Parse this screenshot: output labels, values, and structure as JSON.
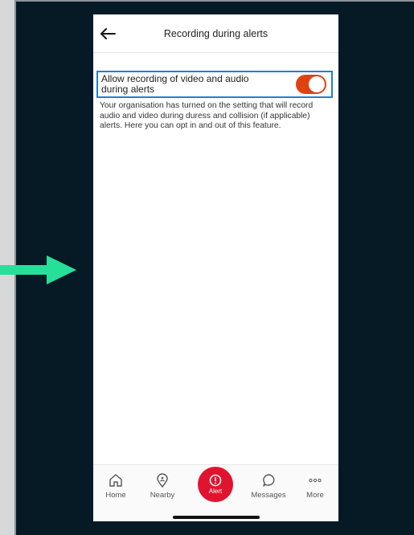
{
  "header": {
    "title": "Recording during alerts"
  },
  "setting": {
    "label": "Allow recording of video and audio during alerts",
    "enabled": true,
    "description": "Your organisation has turned on the setting that will record audio and video during duress and collision (if applicable) alerts. Here you can opt in and out of this feature."
  },
  "nav": {
    "home": "Home",
    "nearby": "Nearby",
    "alert": "Alert",
    "messages": "Messages",
    "more": "More"
  },
  "colors": {
    "accent_toggle": "#e0420f",
    "alert": "#e1142f",
    "highlight": "#1f7fd6",
    "arrow": "#26e09a"
  }
}
